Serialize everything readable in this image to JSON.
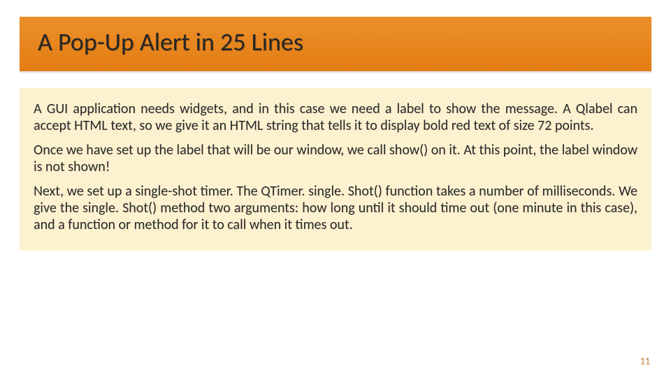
{
  "slide": {
    "title": "A Pop-Up Alert in 25 Lines",
    "paragraphs": [
      "A GUI application needs widgets, and in this case we need a label to show the message. A Qlabel can accept HTML text, so we give it an HTML string that tells it to display bold red text of size 72 points.",
      "Once we have set up the label that will be our window, we call show() on it. At this point, the label window is not shown!",
      "Next, we set up a single-shot timer. The QTimer. single. Shot() function takes a number of milliseconds. We give the single. Shot() method two arguments: how long until it should time out (one minute in this case), and a function or method for it to call when it times out."
    ],
    "page_number": "11"
  }
}
